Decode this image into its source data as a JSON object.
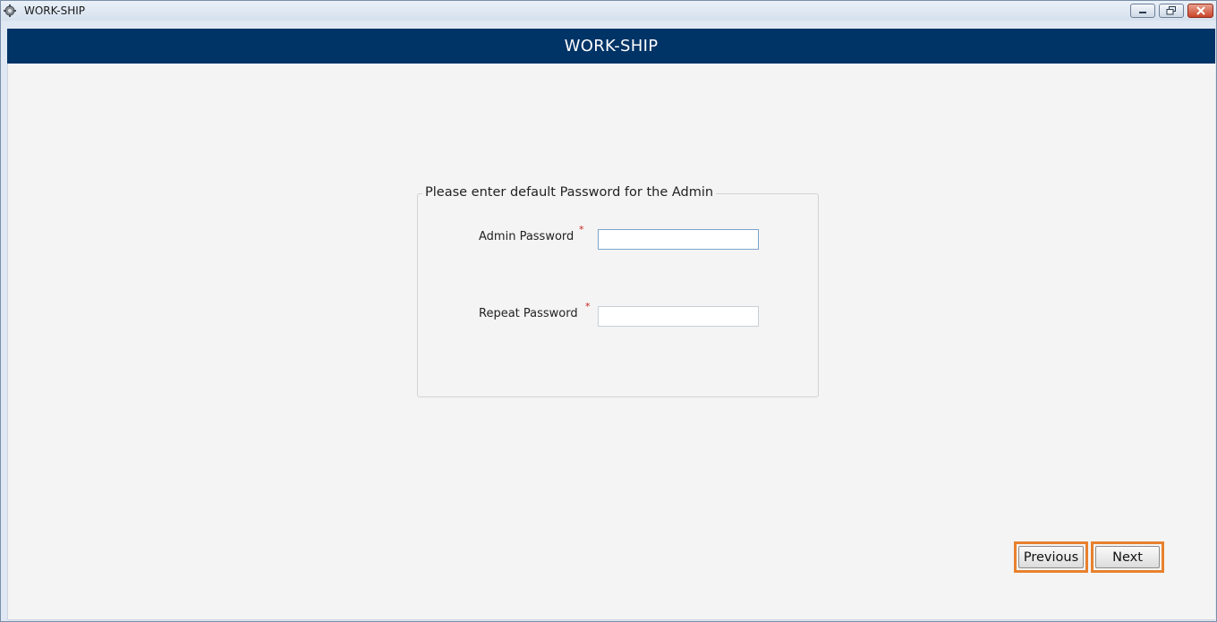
{
  "window": {
    "title": "WORK-SHIP",
    "controls": {
      "minimize_icon": "minimize-icon",
      "restore_icon": "restore-icon",
      "close_icon": "close-icon"
    }
  },
  "header": {
    "title": "WORK-SHIP",
    "background": "#003366"
  },
  "form": {
    "legend": "Please enter default Password for the Admin",
    "fields": [
      {
        "label": "Admin Password",
        "required_mark": "*",
        "value": "",
        "placeholder": ""
      },
      {
        "label": "Repeat Password",
        "required_mark": "*",
        "value": "",
        "placeholder": ""
      }
    ]
  },
  "navigation": {
    "previous_label": "Previous",
    "next_label": "Next",
    "highlight_color": "#e8812e"
  }
}
